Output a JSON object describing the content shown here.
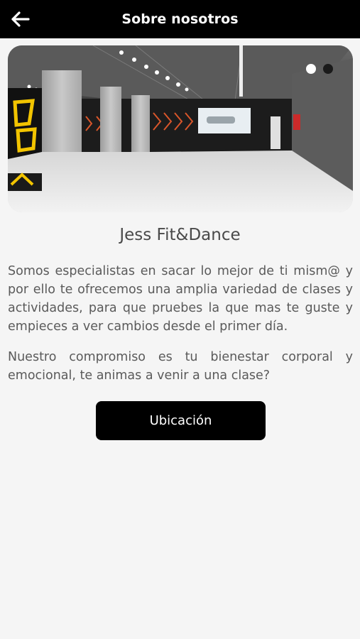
{
  "header": {
    "title": "Sobre nosotros",
    "back_icon": "arrow-left-icon"
  },
  "carousel": {
    "image_description": "gym interior",
    "dots": [
      {
        "active": true
      },
      {
        "active": false
      }
    ]
  },
  "about": {
    "company_name": "Jess Fit&Dance",
    "paragraph1": "Somos especialistas en sacar lo mejor de ti mism@ y por ello te ofrecemos una amplia variedad de clases y actividades, para que pruebes la que mas te guste y empieces a ver cambios desde el primer día.",
    "paragraph2": "Nuestro compromiso es tu bienestar corporal y emocional, te animas a venir a una clase?"
  },
  "actions": {
    "location_label": "Ubicación"
  },
  "colors": {
    "header_bg": "#000000",
    "page_bg": "#f5f5f5",
    "text": "#5a5a5a",
    "button_bg": "#000000",
    "accent_yellow": "#f2c400"
  }
}
